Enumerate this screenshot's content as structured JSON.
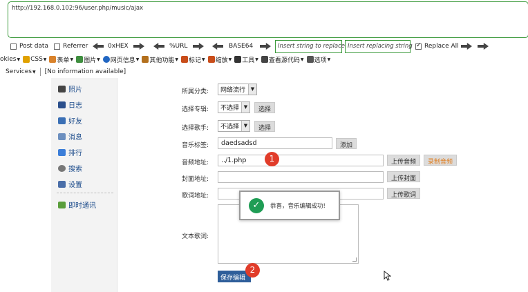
{
  "hackbar": {
    "url": "http://192.168.0.102:96/user.php/music/ajax",
    "post_data_label": "Post data",
    "referrer_label": "Referrer",
    "hex_label": "0xHEX",
    "url_enc_label": "%URL",
    "base64_label": "BASE64",
    "insert_replace_placeholder": "Insert string to replace",
    "insert_replacing_placeholder": "Insert replacing string",
    "replace_all_label": "Replace All",
    "replace_all_checked": true
  },
  "webdev_menu": [
    {
      "label": "okies",
      "icon": "cookie-icon",
      "color": "#9a6b2f"
    },
    {
      "label": "CSS",
      "icon": "css-pencil-icon",
      "color": "#e0a100"
    },
    {
      "label": "表单",
      "icon": "form-icon",
      "color": "#d9822b"
    },
    {
      "label": "图片",
      "icon": "image-icon",
      "color": "#3f8f3f"
    },
    {
      "label": "网页信息",
      "icon": "info-icon",
      "color": "#2166c2"
    },
    {
      "label": "其他功能",
      "icon": "book-icon",
      "color": "#b3701d"
    },
    {
      "label": "标记",
      "icon": "marker-icon",
      "color": "#c94d1a"
    },
    {
      "label": "缩放",
      "icon": "resize-icon",
      "color": "#c94d1a"
    },
    {
      "label": "工具",
      "icon": "tools-icon",
      "color": "#333333"
    },
    {
      "label": "查看源代码",
      "icon": "source-icon",
      "color": "#444444"
    },
    {
      "label": "选项",
      "icon": "options-icon",
      "color": "#555555"
    }
  ],
  "services": {
    "label": "Services",
    "status": "[No information available]"
  },
  "sidebar": {
    "items": [
      {
        "label": "照片",
        "icon": "photo-icon",
        "color": "#444"
      },
      {
        "label": "日志",
        "icon": "journal-icon",
        "color": "#2b4f8c"
      },
      {
        "label": "好友",
        "icon": "friends-icon",
        "color": "#3a6fb5"
      },
      {
        "label": "消息",
        "icon": "message-icon",
        "color": "#6c8fbf"
      },
      {
        "label": "排行",
        "icon": "ranking-icon",
        "color": "#3b7dd8"
      },
      {
        "label": "搜索",
        "icon": "search-icon",
        "color": "#777"
      },
      {
        "label": "设置",
        "icon": "settings-icon",
        "color": "#4a6ea8"
      }
    ],
    "chat": {
      "label": "即时通讯",
      "icon": "chat-icon",
      "color": "#5a9e3c"
    }
  },
  "form": {
    "category_label": "所属分类:",
    "category_value": "网络流行",
    "album_label": "选择专辑:",
    "album_value": "不选择",
    "album_button": "选择",
    "singer_label": "选择歌手:",
    "singer_value": "不选择",
    "singer_button": "选择",
    "tag_label": "音乐标签:",
    "tag_value": "daedsadsd",
    "tag_button": "添加",
    "audio_label": "音频地址:",
    "audio_value": "../1.php",
    "upload_audio_button": "上传音频",
    "record_audio_button": "录制音频",
    "cover_label": "封面地址:",
    "cover_value": "",
    "upload_cover_button": "上传封面",
    "lyric_url_label": "歌词地址:",
    "lyric_url_value": "",
    "upload_lyric_button": "上传歌词",
    "lyrics_text_label": "文本歌词:",
    "save_button": "保存编辑"
  },
  "toast": {
    "message": "恭喜，音乐编辑成功!",
    "icon": "checkmark-icon"
  },
  "badges": {
    "first": "1",
    "second": "2"
  }
}
